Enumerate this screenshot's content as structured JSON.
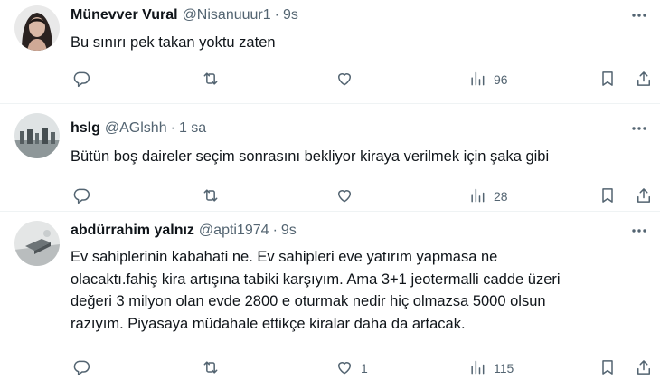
{
  "tweets": [
    {
      "display_name": "Münevver Vural",
      "handle": "@Nisanuuur1",
      "separator": "·",
      "time": "9s",
      "text_lines": [
        "Bu sınırı pek takan yoktu zaten"
      ],
      "stats": {
        "replies": "",
        "retweets": "",
        "likes": "",
        "views": "96"
      }
    },
    {
      "display_name": "hslg",
      "handle": "@AGlshh",
      "separator": "·",
      "time": "1 sa",
      "text_lines": [
        "Bütün boş daireler seçim sonrasını bekliyor kiraya verilmek için şaka gibi"
      ],
      "stats": {
        "replies": "",
        "retweets": "",
        "likes": "",
        "views": "28"
      }
    },
    {
      "display_name": "abdürrahim yalnız",
      "handle": "@apti1974",
      "separator": "·",
      "time": "9s",
      "text_lines": [
        "Ev sahiplerinin kabahati ne. Ev sahipleri eve yatırım yapmasa ne",
        "olacaktı.fahiş kira artışına tabiki karşıyım. Ama 3+1 jeotermalli cadde üzeri",
        "değeri 3 milyon olan evde 2800 e oturmak nedir hiç olmazsa 5000 olsun",
        "razıyım. Piyasaya müdahale ettikçe kiralar daha da artacak."
      ],
      "stats": {
        "replies": "",
        "retweets": "",
        "likes": "1",
        "views": "115"
      }
    }
  ],
  "icons": [
    "more-icon",
    "reply-icon",
    "retweet-icon",
    "like-icon",
    "views-icon",
    "bookmark-icon",
    "share-icon"
  ],
  "colors": {
    "text": "#0f1419",
    "secondary": "#536471",
    "divider": "#eff3f4",
    "background": "#ffffff"
  }
}
